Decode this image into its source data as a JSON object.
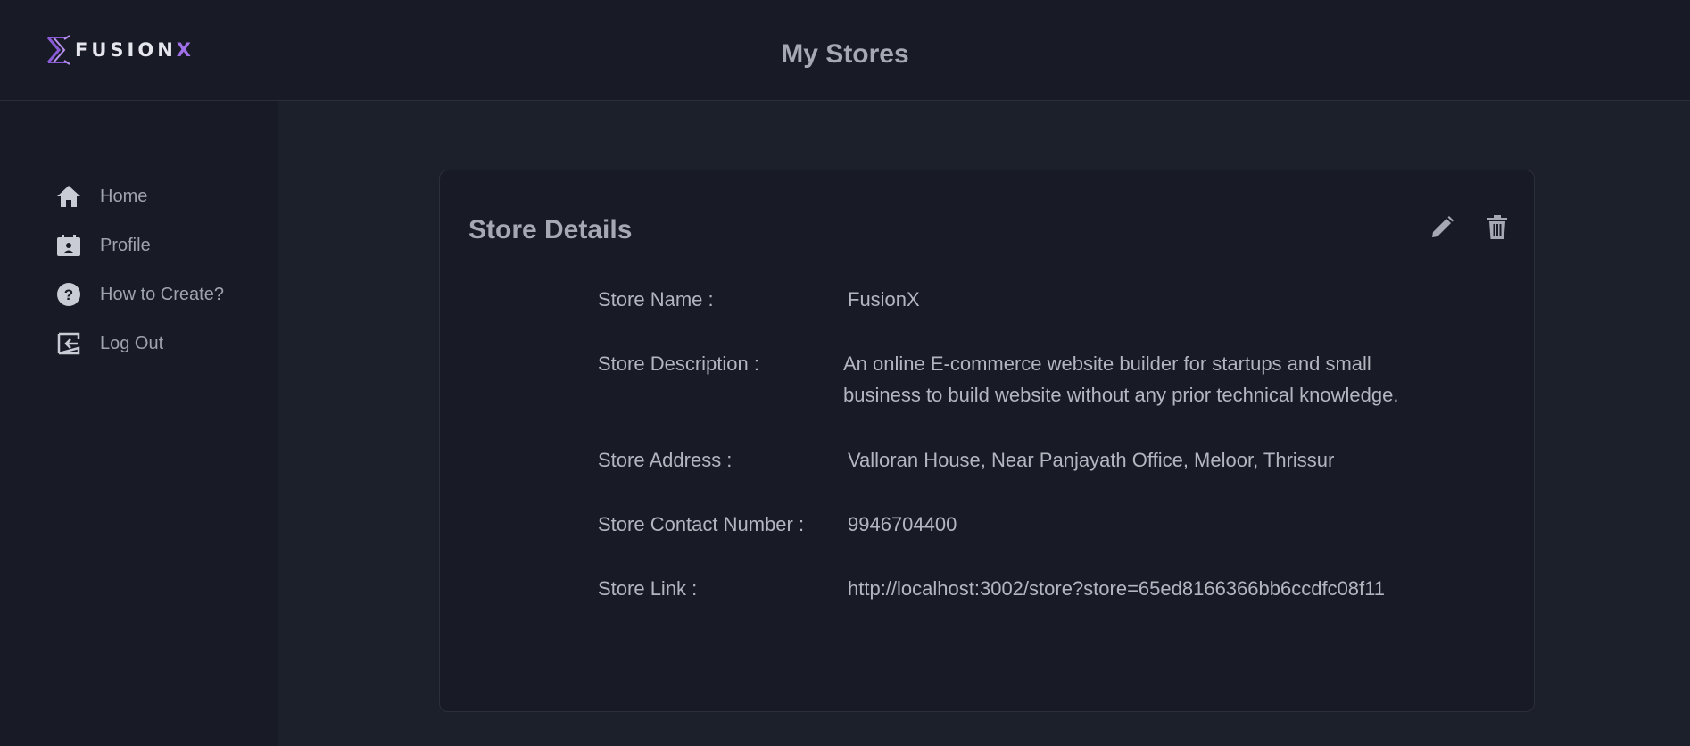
{
  "header": {
    "logo_text_main": "FUSION",
    "logo_text_accent": "X",
    "title": "My Stores"
  },
  "sidebar": {
    "items": [
      {
        "label": "Home",
        "icon": "home-icon"
      },
      {
        "label": "Profile",
        "icon": "profile-badge-icon"
      },
      {
        "label": "How to Create?",
        "icon": "help-circle-icon"
      },
      {
        "label": "Log Out",
        "icon": "logout-icon"
      }
    ]
  },
  "card": {
    "title": "Store Details",
    "edit_icon": "pencil-icon",
    "delete_icon": "trash-icon",
    "fields": [
      {
        "label": "Store Name :",
        "value": "FusionX"
      },
      {
        "label": "Store Description :",
        "value": "An online E-commerce website builder for startups and small business to build website without any prior technical knowledge."
      },
      {
        "label": "Store Address :",
        "value": "Valloran House, Near Panjayath Office, Meloor, Thrissur"
      },
      {
        "label": "Store Contact Number :",
        "value": "9946704400"
      },
      {
        "label": "Store Link :",
        "value": "http://localhost:3002/store?store=65ed8166366bb6ccdfc08f11"
      }
    ]
  },
  "colors": {
    "background": "#1b202b",
    "panel": "#181b25",
    "text": "#b3b6bf",
    "accent": "#a070e8"
  }
}
